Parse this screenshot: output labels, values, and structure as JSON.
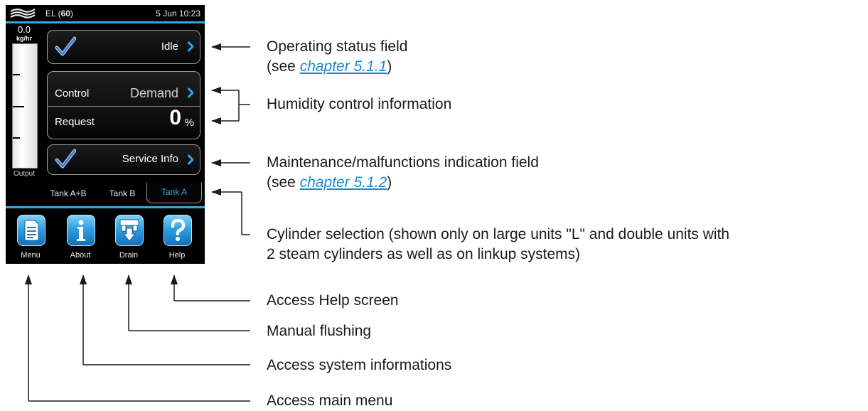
{
  "screen": {
    "logo_icon": "wave-logo-icon",
    "unit_label_prefix": "EL (",
    "unit_label_num": "60",
    "unit_label_suffix": ")",
    "datetime": "5 Jun 10:23",
    "output_value": "0.0",
    "output_unit": "kg/hr",
    "output_label": "Output",
    "status": {
      "text": "Idle",
      "icon": "checkmark-icon"
    },
    "control": {
      "label": "Control",
      "value": "Demand"
    },
    "request": {
      "label": "Request",
      "value": "0",
      "unit": "%"
    },
    "service": {
      "text": "Service Info",
      "icon": "checkmark-icon"
    },
    "tabs": [
      "Tank A+B",
      "Tank B",
      "Tank A"
    ],
    "active_tab": "Tank A",
    "nav": [
      {
        "label": "Menu",
        "icon": "document-icon"
      },
      {
        "label": "About",
        "icon": "info-icon"
      },
      {
        "label": "Drain",
        "icon": "drain-icon"
      },
      {
        "label": "Help",
        "icon": "help-icon"
      }
    ],
    "accent_color": "#3aa6e0"
  },
  "annotations": {
    "status_line1": "Operating status field",
    "status_line2_pre": "(see ",
    "status_link": "chapter 5.1.1",
    "status_line2_post": ")",
    "humidity": "Humidity control information",
    "maint_line1": "Maintenance/malfunctions indication field",
    "maint_line2_pre": "(see ",
    "maint_link": "chapter 5.1.2",
    "maint_line2_post": ")",
    "cyl_line1": "Cylinder selection (shown only on large units \"L\" and double units with",
    "cyl_line2": "2 steam cylinders as well as on linkup systems)",
    "help": "Access Help screen",
    "drain": "Manual flushing",
    "about": "Access system informations",
    "menu": "Access main menu"
  }
}
